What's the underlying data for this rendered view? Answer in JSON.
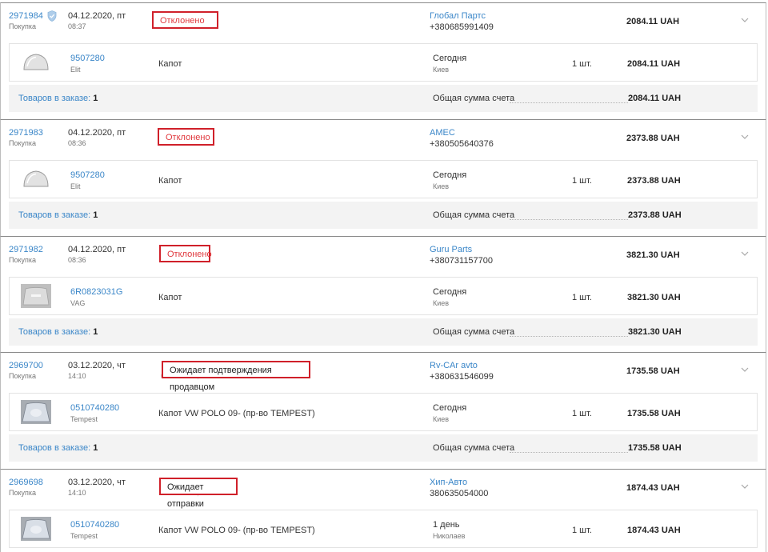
{
  "orders": [
    {
      "id": "2971984",
      "has_shield": true,
      "type": "Покупка",
      "date": "04.12.2020, пт",
      "time": "08:37",
      "status": "Отклонено",
      "status_style": "red",
      "status_ghost": "",
      "vendor": "Глобал Партс",
      "phone": "+380685991409",
      "total": "2084.11 UAH",
      "item": {
        "article": "9507280",
        "brand": "Elit",
        "name": "Капот",
        "delivery": "Сегодня",
        "city": "Киев",
        "qty": "1 шт.",
        "total": "2084.11 UAH",
        "thumb": "hood-gray"
      },
      "footer": {
        "count_label": "Товаров в заказе:",
        "count": "1",
        "sum_label": "Общая сумма счета",
        "sum": "2084.11 UAH"
      }
    },
    {
      "id": "2971983",
      "has_shield": false,
      "type": "Покупка",
      "date": "04.12.2020, пт",
      "time": "08:36",
      "status": "Отклонено",
      "status_style": "red",
      "status_ghost": "",
      "vendor": "AMEC",
      "phone": "+380505640376",
      "total": "2373.88 UAH",
      "item": {
        "article": "9507280",
        "brand": "Elit",
        "name": "Капот",
        "delivery": "Сегодня",
        "city": "Киев",
        "qty": "1 шт.",
        "total": "2373.88 UAH",
        "thumb": "hood-gray"
      },
      "footer": {
        "count_label": "Товаров в заказе:",
        "count": "1",
        "sum_label": "Общая сумма счета",
        "sum": "2373.88 UAH"
      }
    },
    {
      "id": "2971982",
      "has_shield": false,
      "type": "Покупка",
      "date": "04.12.2020, пт",
      "time": "08:36",
      "status": "Отклонено",
      "status_style": "red",
      "status_ghost": "",
      "vendor": "Guru Parts",
      "phone": "+380731157700",
      "total": "3821.30 UAH",
      "item": {
        "article": "6R0823031G",
        "brand": "VAG",
        "name": "Капот",
        "delivery": "Сегодня",
        "city": "Киев",
        "qty": "1 шт.",
        "total": "3821.30 UAH",
        "thumb": "hood-photo"
      },
      "footer": {
        "count_label": "Товаров в заказе:",
        "count": "1",
        "sum_label": "Общая сумма счета",
        "sum": "3821.30 UAH"
      }
    },
    {
      "id": "2969700",
      "has_shield": false,
      "type": "Покупка",
      "date": "03.12.2020, чт",
      "time": "14:10",
      "status": "Ожидает подтверждения продавцом",
      "status_style": "dark",
      "status_ghost": "03.12.2020, чт",
      "vendor": "Rv-CAr avto",
      "phone": "+380631546099",
      "total": "1735.58 UAH",
      "item": {
        "article": "0510740280",
        "brand": "Tempest",
        "name": "Капот VW POLO 09- (пр-во TEMPEST)",
        "delivery": "Сегодня",
        "city": "Киев",
        "qty": "1 шт.",
        "total": "1735.58 UAH",
        "thumb": "hood-blue"
      },
      "footer": {
        "count_label": "Товаров в заказе:",
        "count": "1",
        "sum_label": "Общая сумма счета",
        "sum": "1735.58 UAH"
      }
    },
    {
      "id": "2969698",
      "has_shield": false,
      "type": "Покупка",
      "date": "03.12.2020, чт",
      "time": "14:10",
      "status": "Ожидает отправки",
      "status_style": "dark",
      "status_ghost": "03.12.2020, чт",
      "vendor": "Хип-Авто",
      "phone": "380635054000",
      "total": "1874.43 UAH",
      "item": {
        "article": "0510740280",
        "brand": "Tempest",
        "name": "Капот VW POLO 09- (пр-во TEMPEST)",
        "delivery": "1 день",
        "city": "Николаев",
        "qty": "1 шт.",
        "total": "1874.43 UAH",
        "thumb": "hood-blue"
      },
      "footer": null
    }
  ]
}
